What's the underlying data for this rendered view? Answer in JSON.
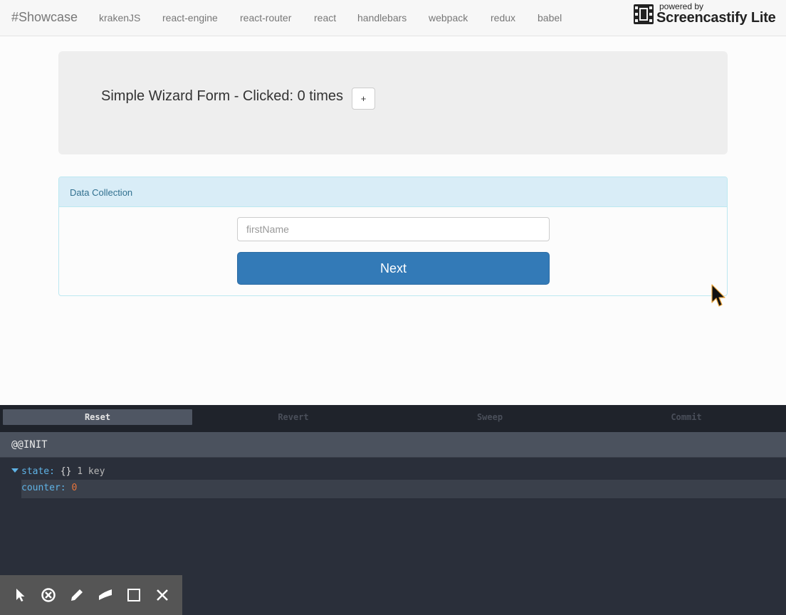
{
  "navbar": {
    "brand": "#Showcase",
    "items": [
      "krakenJS",
      "react-engine",
      "react-router",
      "react",
      "handlebars",
      "webpack",
      "redux",
      "babel"
    ]
  },
  "watermark": {
    "small": "powered by",
    "big": "Screencastify Lite"
  },
  "jumbotron": {
    "title": "Simple Wizard Form - Clicked: 0 times",
    "plus_label": "+"
  },
  "panel": {
    "title": "Data Collection",
    "input_placeholder": "firstName",
    "input_value": "",
    "next_label": "Next"
  },
  "devtools": {
    "buttons": [
      "Reset",
      "Revert",
      "Sweep",
      "Commit"
    ],
    "active_button": "Reset",
    "action": "@@INIT",
    "state_key": "state:",
    "state_braces": "{}",
    "state_count": "1 key",
    "counter_key": "counter:",
    "counter_value": "0"
  },
  "annotation_toolbar": {
    "icons": [
      "cursor-icon",
      "no-entry-icon",
      "pencil-icon",
      "highlighter-icon",
      "square-icon",
      "close-icon"
    ]
  },
  "colors": {
    "primary": "#337ab7",
    "panel_heading": "#d9edf7",
    "panel_title": "#31708f",
    "devtools_bg": "#2a2f3a",
    "key_blue": "#5fb3e6",
    "number_orange": "#e8743b"
  }
}
